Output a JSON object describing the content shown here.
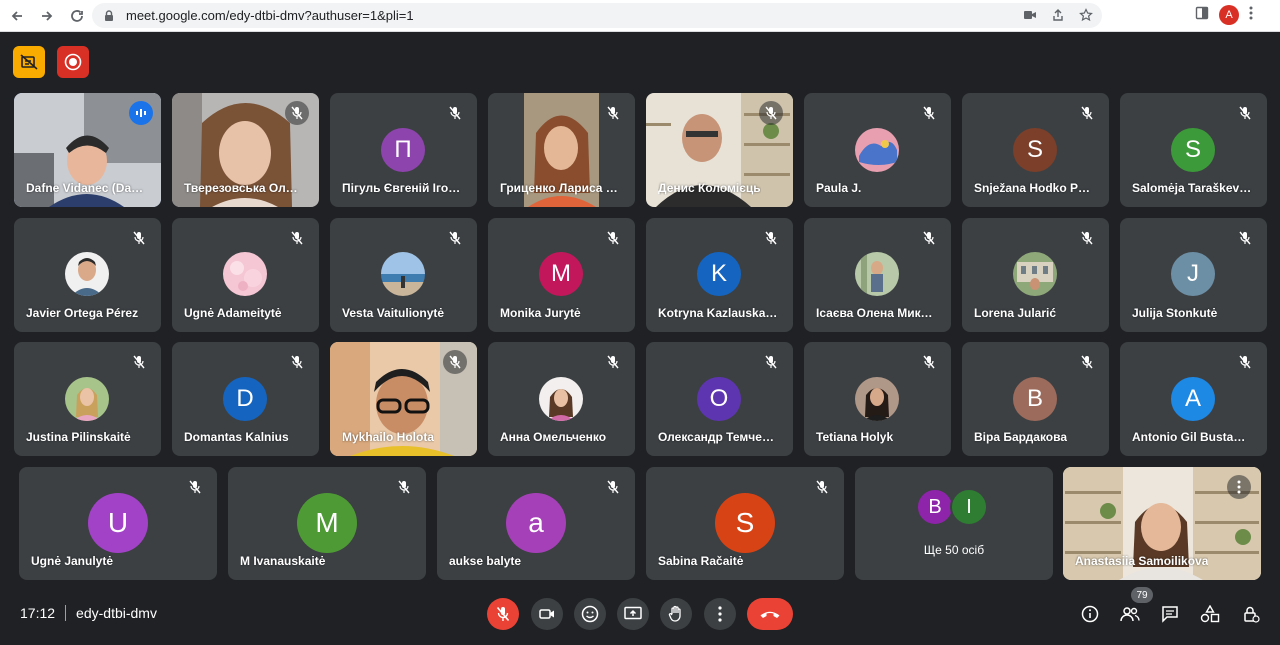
{
  "browser": {
    "url": "meet.google.com/edy-dtbi-dmv?authuser=1&pli=1",
    "profile_initial": "A"
  },
  "meeting": {
    "time": "17:12",
    "code": "edy-dtbi-dmv",
    "participant_count": "79"
  },
  "tiles": [
    {
      "name": "Dafne Vidanec (Dap..."
    },
    {
      "name": "Тверезовська Олек..."
    },
    {
      "name": "Пігуль Євгеній Ігор...",
      "initial": "П"
    },
    {
      "name": "Гриценко Лариса Л..."
    },
    {
      "name": "Денис Коломієць"
    },
    {
      "name": "Paula J."
    },
    {
      "name": "Snježana Hodko Pav...",
      "initial": "S"
    },
    {
      "name": "Salomėja Taraškevič...",
      "initial": "S"
    },
    {
      "name": "Javier Ortega Pérez"
    },
    {
      "name": "Ugnė Adameitytė"
    },
    {
      "name": "Vesta Vaitulionytė"
    },
    {
      "name": "Monika Jurytė",
      "initial": "M"
    },
    {
      "name": "Kotryna Kazlauskaitė",
      "initial": "K"
    },
    {
      "name": "Ісаєва Олена Мико..."
    },
    {
      "name": "Lorena Jularić"
    },
    {
      "name": "Julija Stonkutė",
      "initial": "J"
    },
    {
      "name": "Justina Pilinskaitė"
    },
    {
      "name": "Domantas Kalnius",
      "initial": "D"
    },
    {
      "name": "Mykhailo Holota"
    },
    {
      "name": "Анна Омельченко"
    },
    {
      "name": "Олександр Темчен...",
      "initial": "О"
    },
    {
      "name": "Tetiana Holyk"
    },
    {
      "name": "Віра Бардакова",
      "initial": "В"
    },
    {
      "name": "Antonio Gil Bustam...",
      "initial": "A"
    },
    {
      "name": "Ugnė Janulytė",
      "initial": "U"
    },
    {
      "name": "M Ivanauskaitė",
      "initial": "M"
    },
    {
      "name": "aukse balyte",
      "initial": "a"
    },
    {
      "name": "Sabina Račaitė",
      "initial": "S"
    },
    {
      "name": "Anastasiia Samoilikova"
    }
  ],
  "more": {
    "label": "Ще 50 осіб",
    "initials": [
      "B",
      "I"
    ]
  },
  "colors": {
    "purple": "#8e44ad",
    "brown": "#7b3f2a",
    "green": "#3d9a3a",
    "pink": "#c2185b",
    "blue": "#1565c0",
    "slate": "#6d8fa6",
    "rosybrown": "#9c6b5c",
    "lightblue": "#1e88e5",
    "violet": "#a142c7",
    "olive": "#4e9a35",
    "magenta": "#a640b8",
    "orange": "#d84315",
    "stack_purple": "#8e24aa",
    "stack_green": "#2e7d32"
  },
  "controls": [
    "mic-off-icon",
    "camera-icon",
    "emoji-icon",
    "present-icon",
    "raise-hand-icon",
    "more-options-icon",
    "hang-up-icon"
  ],
  "right_tools": [
    "info-icon",
    "people-icon",
    "chat-icon",
    "activities-icon",
    "host-controls-icon"
  ]
}
